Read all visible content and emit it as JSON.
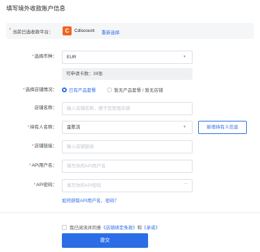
{
  "page": {
    "title": "填写境外收款账户信息"
  },
  "platform": {
    "label": "当前已选收款平台：",
    "logo_letter": "C",
    "name": "Cdiscount",
    "reselect": "重新选择"
  },
  "form": {
    "currency": {
      "label": "选择币种：",
      "value": "EUR"
    },
    "available_cards": {
      "text": "可申请卡数：39张"
    },
    "store_status": {
      "label": "选择店铺情况：",
      "options": [
        "已有产品套餐",
        "暂无产品套餐 / 暂无店铺"
      ],
      "selected": "已有产品套餐"
    },
    "store_name": {
      "label": "店铺名称：",
      "placeholder": "输入店铺名称，便于您管理店铺"
    },
    "holder_name": {
      "label": "持有人名称：",
      "value": "金陈洁"
    },
    "add_holder": "新增持有人信息",
    "store_link": {
      "label": "店铺链接：",
      "placeholder": "输入店铺链接"
    },
    "api_username": {
      "label": "API用户名：",
      "placeholder": "填写你的API用户名"
    },
    "api_password": {
      "label": "API密码：",
      "placeholder": "填写你的API密码"
    },
    "help_link": "如何获取API用户名、密码？"
  },
  "agreement": {
    "prefix": "我已阅读并同意",
    "link1": "《店铺绑定条款》",
    "conjunction": "和",
    "link2": "《承诺》"
  },
  "submit": "提交",
  "colors": {
    "primary": "#2b6de6",
    "required": "#e54b4b",
    "logo": "#f26522"
  }
}
